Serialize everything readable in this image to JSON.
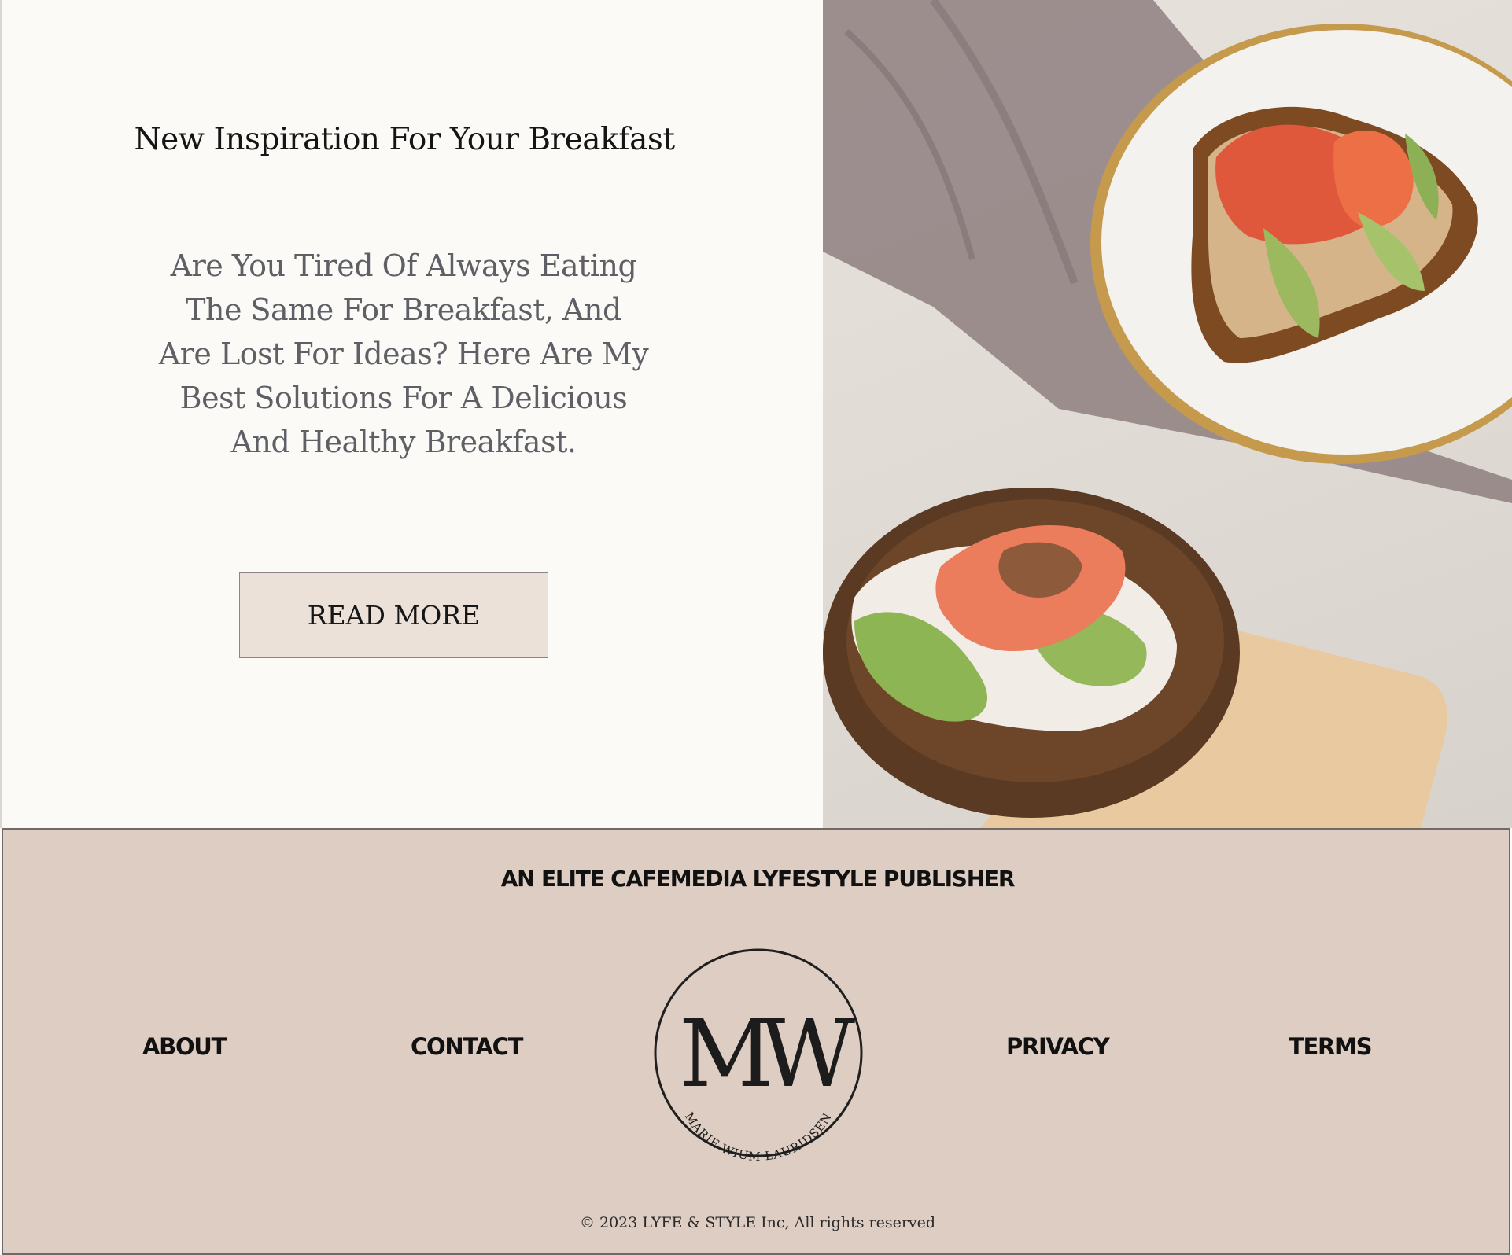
{
  "hero": {
    "title": "New Inspiration For Your Breakfast",
    "body": "Are You Tired Of Always Eating The Same For Breakfast, And Are Lost For Ideas? Here Are My Best Solutions For A Delicious And Healthy Breakfast.",
    "cta_label": "READ MORE",
    "image_icon": "breakfast-toast-photo"
  },
  "footer": {
    "tagline": "AN ELITE CAFEMEDIA  LYFESTYLE PUBLISHER",
    "nav": {
      "about": "ABOUT",
      "contact": "CONTACT",
      "privacy": "PRIVACY",
      "terms": "TERMS"
    },
    "logo": {
      "monogram": "MW",
      "name": "MARIE WIUM LAURIDSEN"
    },
    "copyright": "© 2023 LYFE & STYLE  Inc, All rights reserved"
  },
  "colors": {
    "page_background": "#fbfaf7",
    "button_background": "#ebe1d9",
    "footer_background": "#decdc2",
    "text_dark": "#111111",
    "text_muted": "#5f5f66"
  }
}
